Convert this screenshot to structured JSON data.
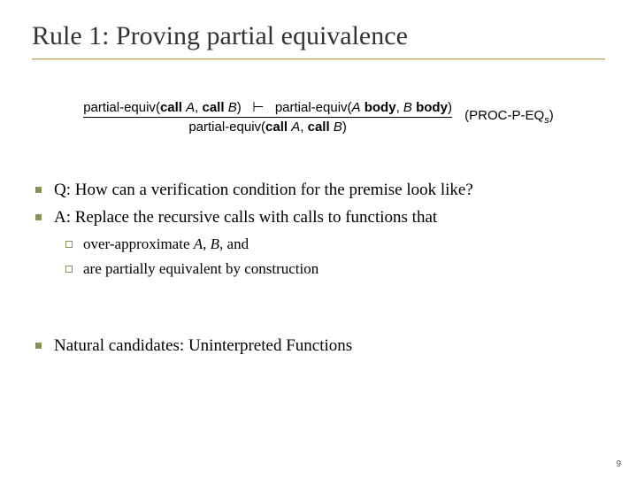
{
  "title": "Rule 1: Proving partial equivalence",
  "rule": {
    "pe": "partial-equiv",
    "call": "call",
    "A": "A",
    "B": "B",
    "body": "body",
    "turnstile": "⊢",
    "name_open": "(",
    "name": "PROC-P-EQ",
    "name_sub": "s",
    "name_close": ")",
    "comma": ", ",
    "lp": "(",
    "rp": ")"
  },
  "bullets": {
    "q": "Q: How can a verification condition for the premise look like?",
    "a": "A: Replace the recursive calls with calls to functions that",
    "sub1_pre": "over-approximate ",
    "sub1_A": "A",
    "sub1_sep": ", ",
    "sub1_B": "B",
    "sub1_sep2": ", ",
    "sub1_post": "and",
    "sub2_pre": "are ",
    "sub2_mid": "partially equivalent",
    "sub2_post": " by construction",
    "nat_pre": "Natural candidates: ",
    "nat": "Uninterpreted Functions"
  },
  "slidenum": "9"
}
